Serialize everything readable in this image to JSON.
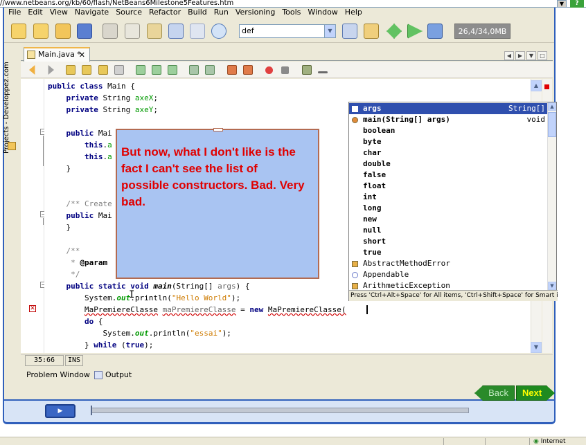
{
  "browser": {
    "url": "//www.netbeans.org/kb/60/flash/NetBeans6Milestone5Features.htm"
  },
  "menu": [
    "File",
    "Edit",
    "View",
    "Navigate",
    "Source",
    "Refactor",
    "Build",
    "Run",
    "Versioning",
    "Tools",
    "Window",
    "Help"
  ],
  "toolbar": {
    "config_value": "def",
    "memory": "26,4/34,0MB"
  },
  "sidebar": {
    "label": "Projects - Developpez.com"
  },
  "editor_tab": {
    "label": "Main.java *"
  },
  "code_lines": [
    {
      "type": "class",
      "text": "public class Main {"
    },
    {
      "type": "field",
      "kw": "private",
      "typ": " String ",
      "name": "axeX",
      "end": ";"
    },
    {
      "type": "field",
      "kw": "private",
      "typ": " String ",
      "name": "axeY",
      "end": ";"
    },
    {
      "type": "plain",
      "text": ""
    },
    {
      "type": "plain",
      "text": "    public Mai"
    },
    {
      "type": "this",
      "text": "        this.a"
    },
    {
      "type": "this",
      "text": "        this.a"
    },
    {
      "type": "plain",
      "text": "    }"
    },
    {
      "type": "plain",
      "text": ""
    },
    {
      "type": "plain",
      "text": ""
    },
    {
      "type": "comment",
      "text": "    /** Create"
    },
    {
      "type": "plain",
      "text": "    public Mai"
    },
    {
      "type": "plain",
      "text": "    }"
    },
    {
      "type": "plain",
      "text": ""
    },
    {
      "type": "comment",
      "text": "    /**"
    },
    {
      "type": "comment",
      "text": "     * @param"
    },
    {
      "type": "comment",
      "text": "     */"
    },
    {
      "type": "main",
      "text": "    public static void main(String[] args) {"
    },
    {
      "type": "println",
      "text": "        System.out.println(\"Hello World\");"
    },
    {
      "type": "error",
      "text": "        MaPremiereClasse maPremiereClasse = new MaPremiereClasse("
    },
    {
      "type": "do",
      "text": "        do {"
    },
    {
      "type": "println2",
      "text": "            System.out.println(\"essai\");"
    },
    {
      "type": "while",
      "text": "        } while (true);"
    }
  ],
  "completion": {
    "items": [
      {
        "name": "args",
        "type": "String[]",
        "icon": "local-variable-icon",
        "selected": true
      },
      {
        "name": "main(String[] args)",
        "type": "void",
        "icon": "method-icon"
      },
      {
        "name": "boolean",
        "type": "",
        "icon": "keyword"
      },
      {
        "name": "byte",
        "type": "",
        "icon": "keyword"
      },
      {
        "name": "char",
        "type": "",
        "icon": "keyword"
      },
      {
        "name": "double",
        "type": "",
        "icon": "keyword"
      },
      {
        "name": "false",
        "type": "",
        "icon": "keyword"
      },
      {
        "name": "float",
        "type": "",
        "icon": "keyword"
      },
      {
        "name": "int",
        "type": "",
        "icon": "keyword"
      },
      {
        "name": "long",
        "type": "",
        "icon": "keyword"
      },
      {
        "name": "new",
        "type": "",
        "icon": "keyword"
      },
      {
        "name": "null",
        "type": "",
        "icon": "keyword"
      },
      {
        "name": "short",
        "type": "",
        "icon": "keyword"
      },
      {
        "name": "true",
        "type": "",
        "icon": "keyword"
      },
      {
        "name": "AbstractMethodError",
        "type": "",
        "icon": "class-icon"
      },
      {
        "name": "Appendable",
        "type": "",
        "icon": "interface-icon"
      },
      {
        "name": "ArithmeticException",
        "type": "",
        "icon": "class-icon"
      }
    ],
    "hint": "Press 'Ctrl+Alt+Space' for All items, 'Ctrl+Shift+Space' for Smart items"
  },
  "callout": {
    "text": "But now, what I don't like is the fact I can't see the list of possible constructors. Bad. Very bad."
  },
  "status": {
    "position": "35:66",
    "mode": "INS"
  },
  "bottom_tabs": {
    "problems": "Problem Window",
    "output": "Output"
  },
  "nav": {
    "back": "Back",
    "next": "Next"
  },
  "browser_status": {
    "zone": "Internet"
  },
  "colors": {
    "selection": "#2f4fae",
    "callout_bg": "#a9c4f2",
    "callout_text": "#e00000",
    "next_text": "#ffff00"
  }
}
